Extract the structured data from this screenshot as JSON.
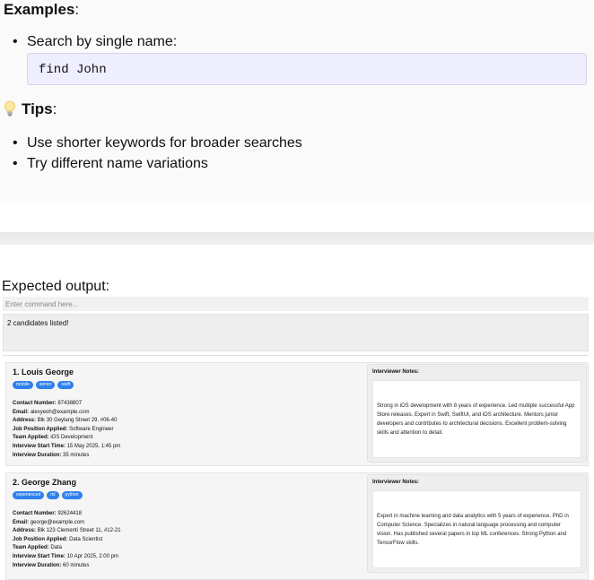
{
  "docs": {
    "examples_heading": "Examples",
    "examples": [
      {
        "text": "Search by single name:",
        "code": "find John"
      }
    ],
    "tips_heading": "Tips",
    "tips_icon": "lightbulb-icon",
    "tips": [
      "Use shorter keywords for broader searches",
      "Try different name variations"
    ]
  },
  "expected_output_label": "Expected output:",
  "command_box": {
    "placeholder": "Enter command here..."
  },
  "result_display": {
    "text": "2 candidates listed!"
  },
  "colors": {
    "tag_bg": "#2f80ed",
    "code_bg": "#eeeeff"
  },
  "candidates": [
    {
      "name": "1. Louis George",
      "tags": [
        "mobile",
        "senior",
        "swift"
      ],
      "fields": {
        "contact_label": "Contact Number:",
        "contact": "87438807",
        "email_label": "Email:",
        "email": "alexyeoh@example.com",
        "address_label": "Address:",
        "address": "Blk 30 Geylang Street 29, #06-40",
        "job_label": "Job Position Applied:",
        "job": "Software Engineer",
        "team_label": "Team Applied:",
        "team": "iOS Development",
        "start_label": "Interview Start Time:",
        "start": "15 May 2025, 1:45 pm",
        "duration_label": "Interview Duration:",
        "duration": "35 minutes"
      },
      "notes_title": "Interviewer Notes:",
      "notes": "Strong in iOS development with 8 years of experience. Led multiple successful App Store releases. Expert in Swift, SwiftUI, and iOS architecture. Mentors junior developers and contributes to architectural decisions. Excellent problem-solving skills and attention to detail."
    },
    {
      "name": "2. George Zhang",
      "tags": [
        "experienced",
        "ml",
        "python"
      ],
      "fields": {
        "contact_label": "Contact Number:",
        "contact": "92624418",
        "email_label": "Email:",
        "email": "george@example.com",
        "address_label": "Address:",
        "address": "Blk 123 Clementi Street 11, #12-21",
        "job_label": "Job Position Applied:",
        "job": "Data Scientist",
        "team_label": "Team Applied:",
        "team": "Data",
        "start_label": "Interview Start Time:",
        "start": "10 Apr 2025, 2:00 pm",
        "duration_label": "Interview Duration:",
        "duration": "60 minutes"
      },
      "notes_title": "Interviewer Notes:",
      "notes": "Expert in machine learning and data analytics with 5 years of experience. PhD in Computer Science. Specializes in natural language processing and computer vision. Has published several papers in top ML conferences. Strong Python and TensorFlow skills."
    }
  ]
}
